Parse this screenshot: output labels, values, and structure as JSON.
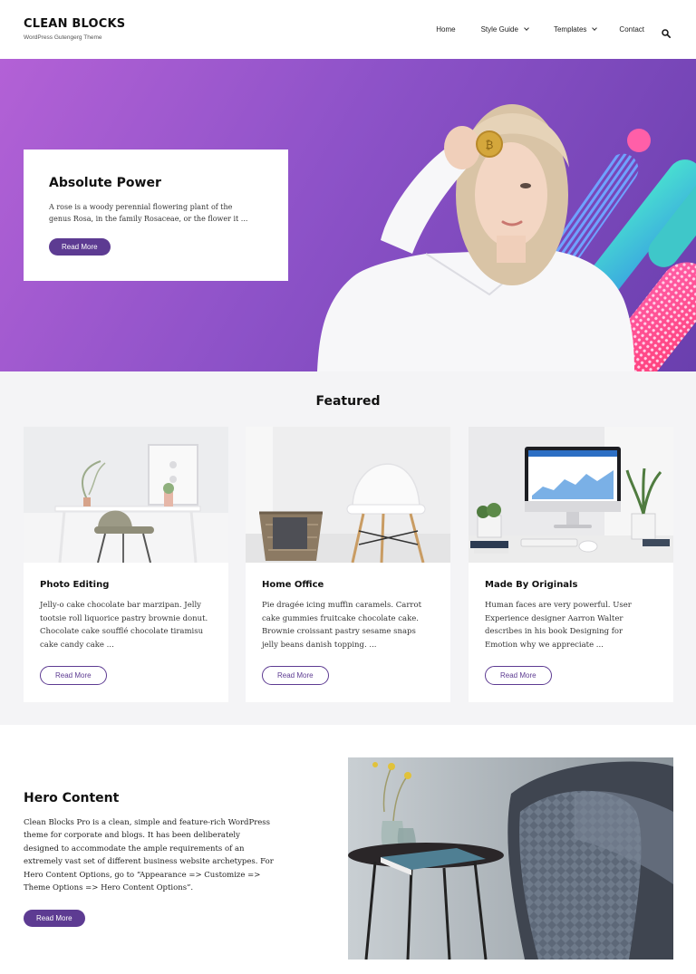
{
  "header": {
    "site_title": "CLEAN BLOCKS",
    "tagline": "WordPress Gutengerg Theme",
    "nav": {
      "home": "Home",
      "style_guide": "Style Guide",
      "templates": "Templates",
      "contact": "Contact"
    }
  },
  "hero": {
    "title": "Absolute Power",
    "text": "A rose is a woody perennial flowering plant of the genus Rosa, in the family Rosaceae, or the flower it ...",
    "button": "Read More"
  },
  "featured": {
    "title": "Featured",
    "cards": [
      {
        "title": "Photo Editing",
        "text": "Jelly-o cake chocolate bar marzipan. Jelly tootsie roll liquorice pastry brownie donut. Chocolate cake soufflé chocolate tiramisu cake candy cake ...",
        "button": "Read More"
      },
      {
        "title": "Home Office",
        "text": "Pie dragée icing muffin caramels. Carrot cake gummies fruitcake chocolate cake. Brownie croissant pastry sesame snaps jelly beans danish topping. ...",
        "button": "Read More"
      },
      {
        "title": "Made By Originals",
        "text": "Human faces are very powerful. User Experience designer Aarron Walter describes in his book Designing for Emotion why we appreciate ...",
        "button": "Read More"
      }
    ]
  },
  "hero_content": {
    "title": "Hero Content",
    "text": "Clean Blocks Pro is a clean, simple and feature-rich WordPress theme for corporate and blogs. It has been deliberately designed to accommodate the ample requirements of an extremely vast set of different business website archetypes. For Hero Content Options, go to “Appearance => Customize => Theme Options => Hero Content Options”.",
    "button": "Read More"
  },
  "colors": {
    "accent": "#5d3b92",
    "hero_gradient_start": "#b361d6",
    "hero_gradient_end": "#6a3fae",
    "section_bg": "#f4f4f6"
  },
  "icons": {
    "search": "search-icon",
    "dropdown": "chevron-down-icon"
  }
}
